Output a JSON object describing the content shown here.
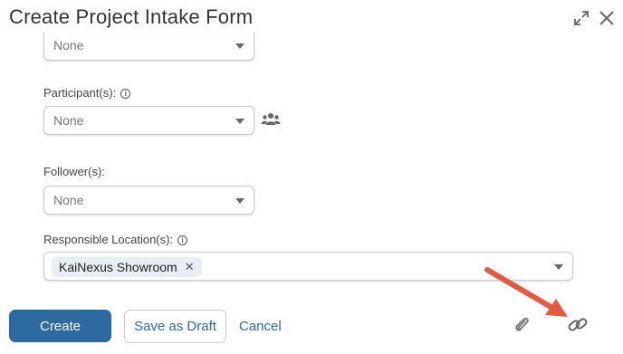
{
  "dialog": {
    "title": "Create Project Intake Form"
  },
  "fields": {
    "top_select": {
      "value": "None"
    },
    "participants": {
      "label": "Participant(s):",
      "value": "None"
    },
    "followers": {
      "label": "Follower(s):",
      "value": "None"
    },
    "responsible_locations": {
      "label": "Responsible Location(s):",
      "chips": [
        "KaiNexus Showroom"
      ],
      "chip_remove": "✕"
    }
  },
  "footer": {
    "create_label": "Create",
    "draft_label": "Save as Draft",
    "cancel_label": "Cancel"
  },
  "icons": {
    "info": "i",
    "expand": "expand-icon",
    "close": "close-icon",
    "users": "users-icon",
    "attach": "paperclip-icon",
    "link": "link-icon"
  },
  "colors": {
    "primary": "#2c6aa0",
    "arrow": "#e35a42"
  }
}
